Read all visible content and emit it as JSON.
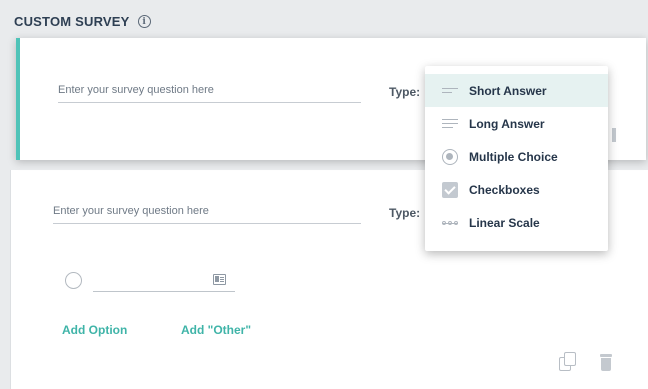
{
  "header": {
    "title": "CUSTOM SURVEY",
    "info_icon": "info-icon"
  },
  "question1": {
    "placeholder": "Enter your survey question here",
    "type_label": "Type:"
  },
  "question2": {
    "placeholder": "Enter your survey question here",
    "type_label": "Type:",
    "add_option": "Add Option",
    "add_other": "Add \"Other\""
  },
  "type_menu": {
    "selected": "Short Answer",
    "items": [
      {
        "label": "Short Answer",
        "icon": "short-answer-icon"
      },
      {
        "label": "Long Answer",
        "icon": "long-answer-icon"
      },
      {
        "label": "Multiple Choice",
        "icon": "multiple-choice-icon"
      },
      {
        "label": "Checkboxes",
        "icon": "checkboxes-icon"
      },
      {
        "label": "Linear Scale",
        "icon": "linear-scale-icon"
      }
    ]
  },
  "colors": {
    "accent": "#3fb4a8",
    "card_border": "#4fc3b8",
    "selected_bg": "#e6f2f1",
    "text_dark": "#26364a"
  }
}
